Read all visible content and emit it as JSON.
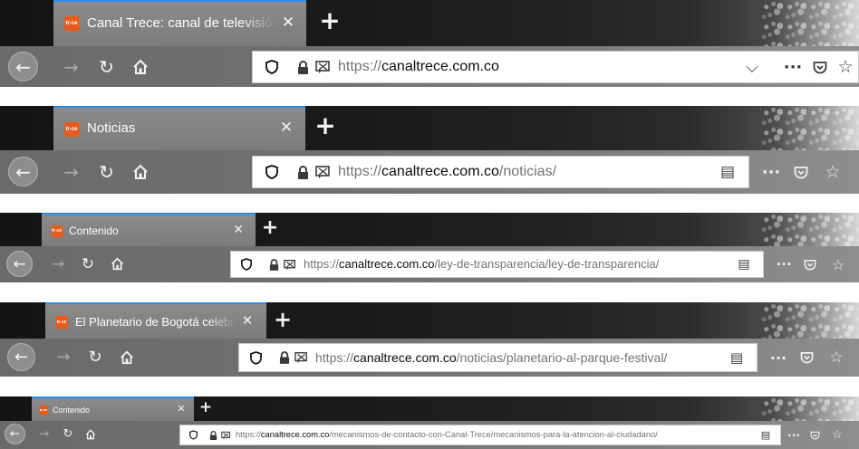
{
  "colors": {
    "accent": "#2a8de9",
    "favicon": "#e85a1c",
    "tab_bg": "#8b8b8b",
    "toolbar_bg": "#727272"
  },
  "icons": {
    "back": "arrow-left-icon",
    "forward": "arrow-right-icon",
    "reload": "reload-icon",
    "home": "home-icon",
    "tracking": "shield-icon",
    "lock": "lock-icon",
    "permissions": "permissions-icon",
    "dropdown": "chevron-down-icon",
    "reader": "reader-view-icon",
    "more": "page-actions-icon",
    "pocket": "pocket-icon",
    "bookmark": "star-icon",
    "close": "close-icon",
    "new_tab": "plus-icon"
  },
  "windows": [
    {
      "favicon": "tr-ce",
      "tab_title": "Canal Trece: canal de televisión",
      "close": "✕",
      "new_tab": "+",
      "url": {
        "scheme": "https://",
        "domain": "canaltrece.com.co",
        "path": ""
      },
      "right_icon": "⌵",
      "more": "···"
    },
    {
      "favicon": "tr-ce",
      "tab_title": "Noticias",
      "close": "✕",
      "new_tab": "+",
      "url": {
        "scheme": "https://",
        "domain": "canaltrece.com.co",
        "path": "/noticias/"
      },
      "right_icon": "▤",
      "more": "···"
    },
    {
      "favicon": "tr-ce",
      "tab_title": "Contenido",
      "close": "✕",
      "new_tab": "+",
      "url": {
        "scheme": "https://",
        "domain": "canaltrece.com.co",
        "path": "/ley-de-transparencia/ley-de-transparencia/"
      },
      "right_icon": "▤",
      "more": "···"
    },
    {
      "favicon": "tr-ce",
      "tab_title": "El Planetario de Bogotá celebra",
      "close": "✕",
      "new_tab": "+",
      "url": {
        "scheme": "https://",
        "domain": "canaltrece.com.co",
        "path": "/noticias/planetario-al-parque-festival/"
      },
      "right_icon": "▤",
      "more": "···"
    },
    {
      "favicon": "tr-ce",
      "tab_title": "Contenido",
      "close": "✕",
      "new_tab": "+",
      "url": {
        "scheme": "https://",
        "domain": "canaltrece.com.co",
        "path": "/mecanismos-de-contacto-con-Canal-Trece/mecanismos-para-la-atencion-al-ciudadano/"
      },
      "right_icon": "▤",
      "more": "···"
    }
  ]
}
